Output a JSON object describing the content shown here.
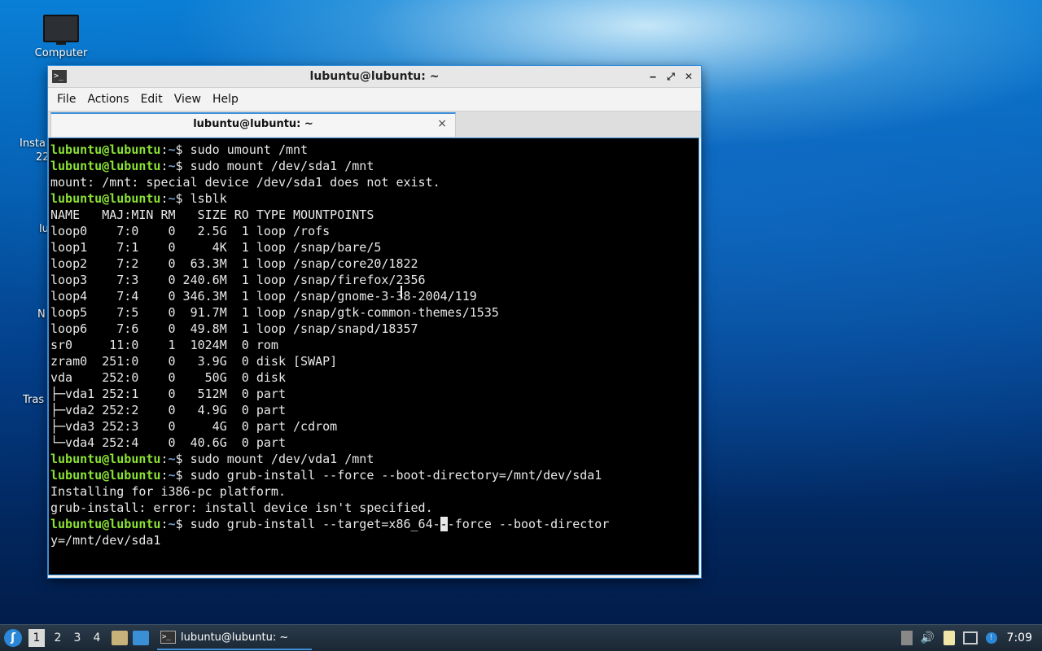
{
  "desktop": {
    "icons": [
      {
        "label": "Computer"
      }
    ],
    "partial_labels": [
      "Insta",
      "22",
      "lu",
      "N",
      "Tras"
    ]
  },
  "window": {
    "title": "lubuntu@lubuntu: ~",
    "controls": {
      "minimize": "‒",
      "maximize": "⤢",
      "close": "✕"
    },
    "menu": [
      "File",
      "Actions",
      "Edit",
      "View",
      "Help"
    ],
    "tab": {
      "label": "lubuntu@lubuntu: ~",
      "close": "×"
    }
  },
  "terminal": {
    "prompt_user": "lubuntu@lubuntu",
    "prompt_sep": ":",
    "prompt_path": "~",
    "prompt_end": "$ ",
    "lines": [
      {
        "type": "cmd",
        "text": "sudo umount /mnt"
      },
      {
        "type": "cmd",
        "text": "sudo mount /dev/sda1 /mnt"
      },
      {
        "type": "out",
        "text": "mount: /mnt: special device /dev/sda1 does not exist."
      },
      {
        "type": "cmd",
        "text": "lsblk"
      },
      {
        "type": "out",
        "text": "NAME   MAJ:MIN RM   SIZE RO TYPE MOUNTPOINTS"
      },
      {
        "type": "out",
        "text": "loop0    7:0    0   2.5G  1 loop /rofs"
      },
      {
        "type": "out",
        "text": "loop1    7:1    0     4K  1 loop /snap/bare/5"
      },
      {
        "type": "out",
        "text": "loop2    7:2    0  63.3M  1 loop /snap/core20/1822"
      },
      {
        "type": "out",
        "text": "loop3    7:3    0 240.6M  1 loop /snap/firefox/2356"
      },
      {
        "type": "out",
        "text": "loop4    7:4    0 346.3M  1 loop /snap/gnome-3-38-2004/119"
      },
      {
        "type": "out",
        "text": "loop5    7:5    0  91.7M  1 loop /snap/gtk-common-themes/1535"
      },
      {
        "type": "out",
        "text": "loop6    7:6    0  49.8M  1 loop /snap/snapd/18357"
      },
      {
        "type": "out",
        "text": "sr0     11:0    1  1024M  0 rom"
      },
      {
        "type": "out",
        "text": "zram0  251:0    0   3.9G  0 disk [SWAP]"
      },
      {
        "type": "out",
        "text": "vda    252:0    0    50G  0 disk"
      },
      {
        "type": "out",
        "text": "├─vda1 252:1    0   512M  0 part"
      },
      {
        "type": "out",
        "text": "├─vda2 252:2    0   4.9G  0 part"
      },
      {
        "type": "out",
        "text": "├─vda3 252:3    0     4G  0 part /cdrom"
      },
      {
        "type": "out",
        "text": "└─vda4 252:4    0  40.6G  0 part"
      },
      {
        "type": "cmd",
        "text": "sudo mount /dev/vda1 /mnt"
      },
      {
        "type": "cmd",
        "text": "sudo grub-install --force --boot-directory=/mnt/dev/sda1"
      },
      {
        "type": "out",
        "text": "Installing for i386-pc platform."
      },
      {
        "type": "out",
        "text": "grub-install: error: install device isn't specified."
      },
      {
        "type": "cmd_cursor",
        "before": "sudo grub-install --target=x86_64-",
        "cursor_char": "-",
        "after": "-force --boot-director"
      },
      {
        "type": "out",
        "text": "y=/mnt/dev/sda1"
      }
    ]
  },
  "taskbar": {
    "start_icon": "lubuntu-logo-icon",
    "workspaces": [
      "1",
      "2",
      "3",
      "4"
    ],
    "active_workspace": "1",
    "task_label": "lubuntu@lubuntu: ~",
    "tray": [
      "network-icon",
      "volume-icon",
      "clipboard-icon",
      "display-icon",
      "notification-icon"
    ],
    "clock": "7:09"
  }
}
